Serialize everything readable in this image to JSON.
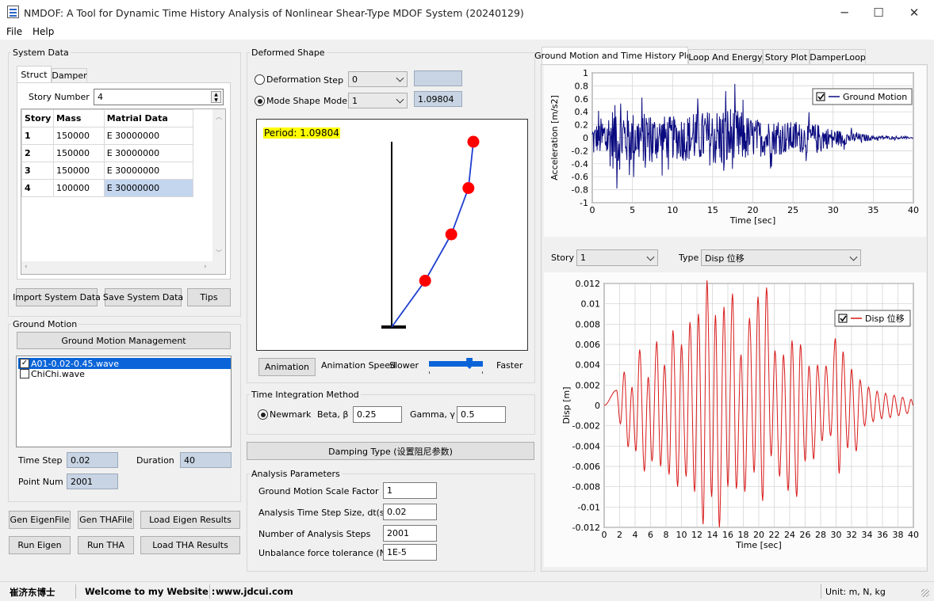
{
  "window": {
    "title": "NMDOF: A Tool for Dynamic Time History Analysis of Nonlinear Shear-Type MDOF System (20240129)",
    "minimize": "─",
    "maximize": "☐",
    "close": "✕"
  },
  "menu": [
    "File",
    "Help"
  ],
  "system_data": {
    "group_label": "System Data",
    "tabs": [
      "Struct",
      "Damper"
    ],
    "story_number_label": "Story Number",
    "story_number_value": "4",
    "table_headers": [
      "Story",
      "Mass",
      "Matrial Data"
    ],
    "rows": [
      {
        "story": "1",
        "mass": "150000",
        "material": "E 30000000"
      },
      {
        "story": "2",
        "mass": "150000",
        "material": "E 30000000"
      },
      {
        "story": "3",
        "mass": "150000",
        "material": "E 30000000"
      },
      {
        "story": "4",
        "mass": "100000",
        "material": "E 30000000"
      }
    ],
    "buttons": [
      "Import System Data",
      "Save System Data",
      "Tips"
    ]
  },
  "ground_motion": {
    "group_label": "Ground Motion",
    "management_button": "Ground Motion Management",
    "list": [
      {
        "name": "A01-0.02-0.45.wave",
        "checked": true,
        "selected": true
      },
      {
        "name": "ChiChi.wave",
        "checked": false,
        "selected": false
      }
    ],
    "time_step_label": "Time Step",
    "time_step_value": "0.02",
    "duration_label": "Duration",
    "duration_value": "40",
    "point_num_label": "Point Num",
    "point_num_value": "2001"
  },
  "action_buttons": [
    "Gen EigenFile",
    "Gen THAFile",
    "Load Eigen Results",
    "Run Eigen",
    "Run THA",
    "Load THA Results"
  ],
  "deformed_shape": {
    "group_label": "Deformed Shape",
    "deformation_label": "Deformation",
    "mode_shape_label": "Mode Shape",
    "step_label": "Step",
    "step_value": "0",
    "mode_label": "Mode",
    "mode_value": "1",
    "step_readout": "",
    "mode_readout": "1.09804",
    "period_text": "Period: 1.09804",
    "animation_button": "Animation",
    "animation_speed_label": "Animation Speed",
    "slower_label": "Slower",
    "faster_label": "Faster",
    "speed_level": 0.8,
    "mode_shape_disp": [
      0,
      0.41,
      0.73,
      0.94,
      1.0
    ]
  },
  "time_integration": {
    "group_label": "Time Integration Method",
    "method_label": "Newmark",
    "beta_label": "Beta, β",
    "beta_value": "0.25",
    "gamma_label": "Gamma, γ",
    "gamma_value": "0.5"
  },
  "damping_button": "Damping Type (设置阻尼参数)",
  "analysis_params": {
    "group_label": "Analysis Parameters",
    "items": [
      {
        "label": "Ground Motion Scale Factor",
        "value": "1"
      },
      {
        "label": "Analysis Time Step Size, dt(s)",
        "value": "0.02"
      },
      {
        "label": "Number of Analysis Steps",
        "value": "2001"
      },
      {
        "label": "Unbalance force tolerance (N)",
        "value": "1E-5"
      }
    ]
  },
  "plot_tabs": [
    "Ground Motion and Time History Plot",
    "Loop And Energy",
    "Story Plot",
    "DamperLoop"
  ],
  "story_selector": {
    "story_label": "Story",
    "story_value": "1",
    "type_label": "Type",
    "type_value": "Disp 位移"
  },
  "status": {
    "author": "崔济东博士",
    "welcome": "Welcome to my Website :",
    "website": "www.jdcui.com",
    "units": "Unit: m, N, kg"
  },
  "colors": {
    "ground_motion_line": "#0a0a80",
    "disp_line": "#d81818",
    "selection": "#0a64d8",
    "period_highlight": "#ffff00",
    "mode_node": "#ff0000"
  },
  "chart_data": [
    {
      "type": "line",
      "series": [
        {
          "name": "Ground Motion"
        }
      ],
      "xlabel": "Time [sec]",
      "ylabel": "Acceleration [m/s2]",
      "xlim": [
        0,
        40
      ],
      "ylim": [
        -1,
        1
      ],
      "xticks": [
        "0",
        "5",
        "10",
        "15",
        "20",
        "25",
        "30",
        "35",
        "40"
      ],
      "yticks": [
        "1",
        "0.8",
        "0.6",
        "0.4",
        "0.2",
        "0",
        "-0.2",
        "-0.4",
        "-0.6",
        "-0.8",
        "-1"
      ],
      "grid": true,
      "legend": "top-right",
      "envelope": {
        "t": [
          0,
          2,
          3,
          5,
          10,
          15,
          17,
          20,
          25,
          28,
          30,
          35,
          40
        ],
        "amp": [
          0.3,
          0.8,
          0.95,
          0.75,
          0.6,
          0.8,
          0.95,
          0.55,
          0.45,
          0.4,
          0.25,
          0.06,
          0.02
        ]
      }
    },
    {
      "type": "line",
      "series": [
        {
          "name": "Disp 位移"
        }
      ],
      "xlabel": "Time [sec]",
      "ylabel": "Disp [m]",
      "xlim": [
        0,
        40
      ],
      "ylim": [
        -0.012,
        0.012
      ],
      "xticks": [
        "0",
        "2",
        "4",
        "6",
        "8",
        "10",
        "12",
        "14",
        "16",
        "18",
        "20",
        "22",
        "24",
        "26",
        "28",
        "30",
        "32",
        "34",
        "36",
        "38",
        "40"
      ],
      "yticks": [
        "0.012",
        "0.01",
        "0.008",
        "0.006",
        "0.004",
        "0.002",
        "0",
        "-0.002",
        "-0.004",
        "-0.006",
        "-0.008",
        "-0.01",
        "-0.012"
      ],
      "grid": true,
      "legend": "top-right",
      "peaks": [
        {
          "t": 1.6,
          "v": 0.0015
        },
        {
          "t": 2.1,
          "v": -0.0018
        },
        {
          "t": 2.6,
          "v": 0.0033
        },
        {
          "t": 3.1,
          "v": -0.0041
        },
        {
          "t": 3.6,
          "v": 0.0018
        },
        {
          "t": 4.1,
          "v": -0.0045
        },
        {
          "t": 4.6,
          "v": 0.0055
        },
        {
          "t": 5.2,
          "v": -0.0065
        },
        {
          "t": 5.7,
          "v": 0.0028
        },
        {
          "t": 6.2,
          "v": -0.0055
        },
        {
          "t": 6.8,
          "v": 0.0063
        },
        {
          "t": 7.3,
          "v": -0.006
        },
        {
          "t": 7.8,
          "v": 0.004
        },
        {
          "t": 8.4,
          "v": -0.0068
        },
        {
          "t": 8.9,
          "v": 0.0074
        },
        {
          "t": 9.5,
          "v": -0.008
        },
        {
          "t": 10.0,
          "v": 0.006
        },
        {
          "t": 10.6,
          "v": -0.007
        },
        {
          "t": 11.1,
          "v": 0.0082
        },
        {
          "t": 11.7,
          "v": -0.0085
        },
        {
          "t": 12.2,
          "v": 0.009
        },
        {
          "t": 12.8,
          "v": -0.0117
        },
        {
          "t": 13.3,
          "v": 0.0123
        },
        {
          "t": 13.9,
          "v": -0.009
        },
        {
          "t": 14.4,
          "v": 0.0089
        },
        {
          "t": 14.9,
          "v": -0.012
        },
        {
          "t": 15.5,
          "v": 0.0097
        },
        {
          "t": 16.0,
          "v": -0.008
        },
        {
          "t": 16.6,
          "v": 0.011
        },
        {
          "t": 17.1,
          "v": -0.0082
        },
        {
          "t": 17.7,
          "v": 0.005
        },
        {
          "t": 18.2,
          "v": -0.0085
        },
        {
          "t": 18.8,
          "v": 0.0086
        },
        {
          "t": 19.4,
          "v": -0.0066
        },
        {
          "t": 19.9,
          "v": 0.0107
        },
        {
          "t": 20.5,
          "v": -0.0094
        },
        {
          "t": 21.0,
          "v": 0.0116
        },
        {
          "t": 21.6,
          "v": -0.005
        },
        {
          "t": 22.1,
          "v": 0.0054
        },
        {
          "t": 22.7,
          "v": -0.007
        },
        {
          "t": 23.2,
          "v": 0.005
        },
        {
          "t": 23.8,
          "v": -0.0084
        },
        {
          "t": 24.3,
          "v": 0.0064
        },
        {
          "t": 24.9,
          "v": -0.009
        },
        {
          "t": 25.4,
          "v": 0.006
        },
        {
          "t": 26.0,
          "v": -0.0055
        },
        {
          "t": 26.5,
          "v": 0.0039
        },
        {
          "t": 27.1,
          "v": -0.0053
        },
        {
          "t": 27.6,
          "v": 0.004
        },
        {
          "t": 28.2,
          "v": -0.0035
        },
        {
          "t": 28.7,
          "v": 0.0039
        },
        {
          "t": 29.3,
          "v": -0.003
        },
        {
          "t": 29.9,
          "v": 0.0066
        },
        {
          "t": 30.4,
          "v": -0.0067
        },
        {
          "t": 30.9,
          "v": 0.0053
        },
        {
          "t": 31.5,
          "v": -0.0042
        },
        {
          "t": 32.0,
          "v": 0.0036
        },
        {
          "t": 32.6,
          "v": -0.0045
        },
        {
          "t": 33.1,
          "v": 0.0025
        },
        {
          "t": 33.7,
          "v": -0.002
        },
        {
          "t": 34.2,
          "v": 0.0018
        },
        {
          "t": 34.8,
          "v": -0.0016
        },
        {
          "t": 35.3,
          "v": 0.0014
        },
        {
          "t": 35.9,
          "v": -0.0013
        },
        {
          "t": 36.4,
          "v": 0.0012
        },
        {
          "t": 37.0,
          "v": -0.0012
        },
        {
          "t": 37.5,
          "v": 0.001
        },
        {
          "t": 38.1,
          "v": -0.001
        },
        {
          "t": 38.6,
          "v": 0.0008
        },
        {
          "t": 39.2,
          "v": -0.0008
        },
        {
          "t": 39.7,
          "v": 0.0006
        },
        {
          "t": 40.0,
          "v": 0.0
        }
      ]
    }
  ]
}
